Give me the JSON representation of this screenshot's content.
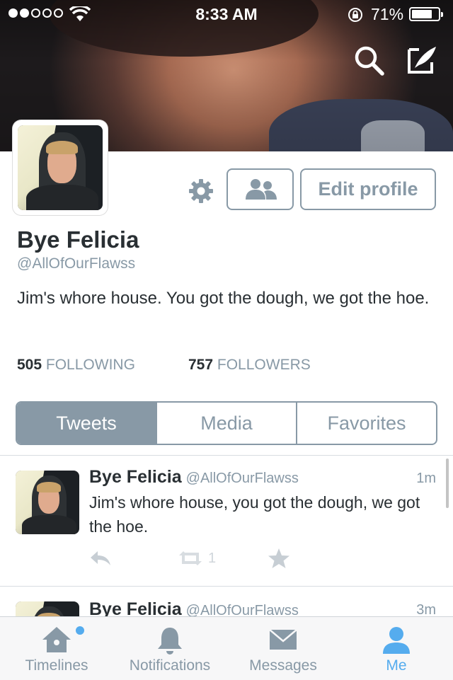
{
  "status_bar": {
    "time": "8:33 AM",
    "battery": "71%"
  },
  "profile": {
    "name": "Bye Felicia",
    "handle": "@AllOfOurFlawss",
    "bio": "Jim's whore house. You got the dough, we got the hoe.",
    "edit_label": "Edit profile",
    "following_count": "505",
    "following_label": "FOLLOWING",
    "followers_count": "757",
    "followers_label": "FOLLOWERS"
  },
  "tabs": [
    {
      "label": "Tweets",
      "active": true
    },
    {
      "label": "Media",
      "active": false
    },
    {
      "label": "Favorites",
      "active": false
    }
  ],
  "tweets": [
    {
      "name": "Bye Felicia",
      "handle": "@AllOfOurFlawss",
      "time": "1m",
      "text": "Jim's whore house, you got the dough, we got the hoe.",
      "retweets": "1"
    },
    {
      "name": "Bye Felicia",
      "handle": "@AllOfOurFlawss",
      "time": "3m",
      "text": ""
    }
  ],
  "tab_bar": [
    {
      "label": "Timelines",
      "icon": "home-icon"
    },
    {
      "label": "Notifications",
      "icon": "bell-icon"
    },
    {
      "label": "Messages",
      "icon": "envelope-icon"
    },
    {
      "label": "Me",
      "icon": "person-icon",
      "active": true
    }
  ],
  "colors": {
    "accent": "#55acee",
    "muted": "#8899a6",
    "text": "#292f33"
  }
}
